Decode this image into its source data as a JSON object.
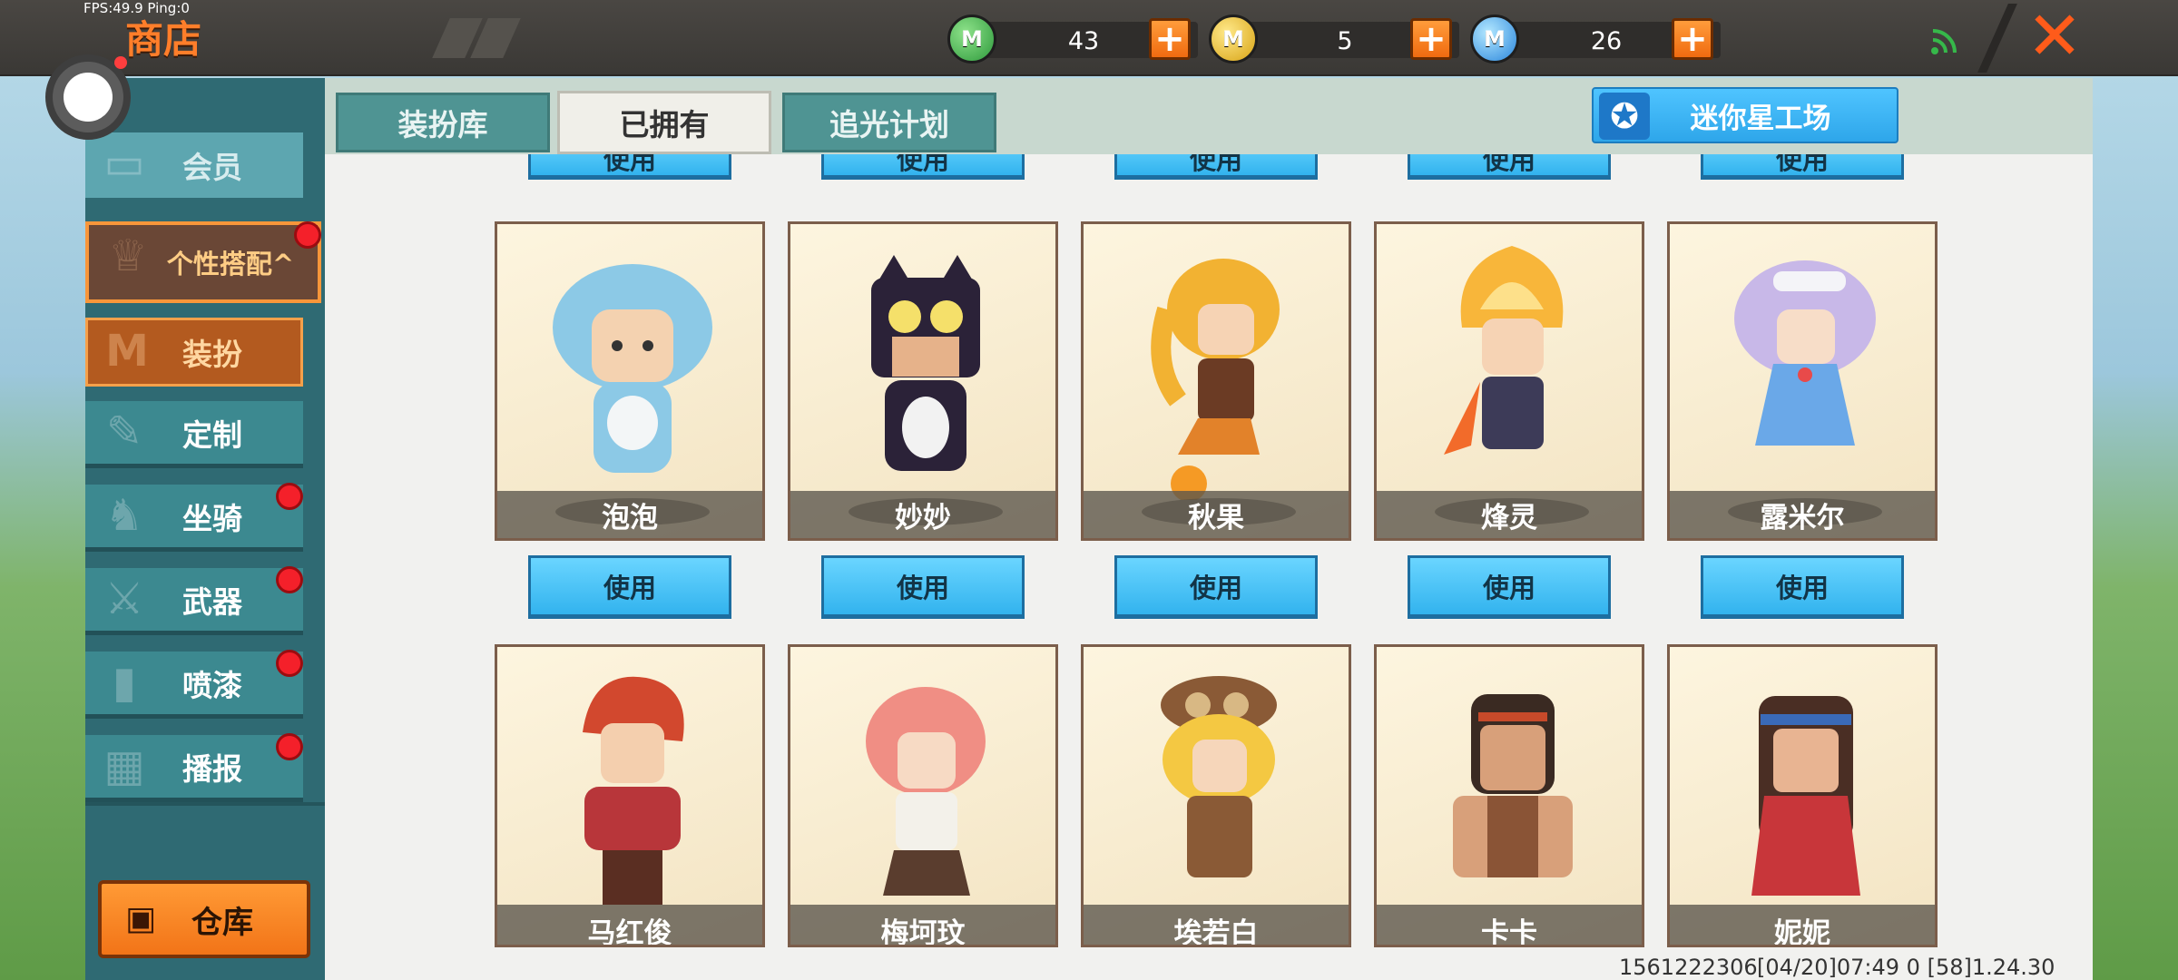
{
  "status": {
    "fps_text": "FPS:49.9  Ping:0"
  },
  "header": {
    "title": "商店",
    "currencies": [
      {
        "icon": "green-m-coin-icon",
        "value": "43",
        "color": "#3aa84a"
      },
      {
        "icon": "gold-m-coin-icon",
        "value": "5",
        "color": "#e6b21c"
      },
      {
        "icon": "blue-m-coin-icon",
        "value": "26",
        "color": "#2a8fe0"
      }
    ],
    "plus_label": "+",
    "close_label": "✕"
  },
  "sidebar": {
    "vip_label": "会员",
    "group_label": "个性搭配^",
    "items": [
      {
        "label": "装扮",
        "active": true,
        "badge": false
      },
      {
        "label": "定制",
        "active": false,
        "badge": false
      },
      {
        "label": "坐骑",
        "active": false,
        "badge": true
      },
      {
        "label": "武器",
        "active": false,
        "badge": true
      },
      {
        "label": "喷漆",
        "active": false,
        "badge": true
      },
      {
        "label": "播报",
        "active": false,
        "badge": true
      }
    ],
    "warehouse_label": "仓库"
  },
  "tabs": [
    {
      "label": "装扮库",
      "active": false
    },
    {
      "label": "已拥有",
      "active": true
    },
    {
      "label": "追光计划",
      "active": false
    }
  ],
  "star_factory_label": "迷你星工场",
  "grid": {
    "use_label": "使用",
    "row1": [
      "泡泡",
      "妙妙",
      "秋果",
      "烽灵",
      "露米尔"
    ],
    "row2": [
      "马红俊",
      "梅坷玟",
      "埃若白",
      "卡卡",
      "妮妮"
    ]
  },
  "footer": {
    "uid": "1561222306",
    "time": "[04/20]07:49 0 [58]1.24.30"
  }
}
